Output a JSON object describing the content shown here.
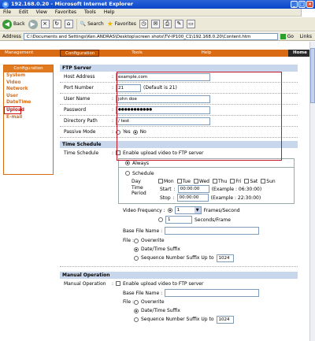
{
  "window": {
    "title": "192.168.0.20 - Microsoft Internet Explorer",
    "menu": [
      "File",
      "Edit",
      "View",
      "Favorites",
      "Tools",
      "Help"
    ],
    "toolbar": {
      "back": "Back",
      "search": "Search",
      "favorites": "Favorites"
    },
    "address_label": "Address",
    "address_value": "C:\\Documents and Settings\\Ken.ANDRAS\\Desktop\\screen shots\\TV-IP100_C1\\192.168.0.20\\Content.htm",
    "go": "Go",
    "links": "Links"
  },
  "nav": {
    "management": "Management",
    "configuration": "Configuration",
    "tools": "Tools",
    "help": "Help",
    "home": "Home"
  },
  "sidebar": {
    "header": "Configuration",
    "items": [
      {
        "label": "System"
      },
      {
        "label": "Video"
      },
      {
        "label": "Network"
      },
      {
        "label": "User"
      },
      {
        "label": "DateTime"
      },
      {
        "label": "Upload"
      },
      {
        "label": "E-mail"
      }
    ],
    "active": "Upload"
  },
  "ftp": {
    "title": "FTP Server",
    "host_label": "Host Address",
    "host_value": "example.com",
    "port_label": "Port Number",
    "port_value": "21",
    "port_default": "(Default is 21)",
    "user_label": "User Name",
    "user_value": "john doe",
    "password_label": "Password",
    "password_value": "●●●●●●●●●●●",
    "dir_label": "Directory Path",
    "dir_value": "/ test",
    "passive_label": "Passive Mode",
    "passive_yes": "Yes",
    "passive_no": "No",
    "passive_selected": "No"
  },
  "schedule": {
    "title": "Time Schedule",
    "row_label": "Time Schedule",
    "enable_label": "Enable upload video to FTP server",
    "always": "Always",
    "schedule": "Schedule",
    "day_label": "Day",
    "days": [
      "Mon",
      "Tue",
      "Wed",
      "Thu",
      "Fri",
      "Sat",
      "Sun"
    ],
    "period_label": "Time Period",
    "start_label": "Start",
    "start_value": "00:00:00",
    "start_example": "(Example : 06:30:00)",
    "stop_label": "Stop",
    "stop_value": "00:00:00",
    "stop_example": "(Example : 22:30:00)",
    "vf_label": "Video Frequency :",
    "fps_value": "1",
    "fps_unit": "Frames/Second",
    "spf_value": "1",
    "spf_unit": "Seconds/Frame",
    "base_label": "Base File Name :",
    "file_label": "File :",
    "overwrite": "Overwrite",
    "datetime_suffix": "Date/Time Suffix",
    "seq_suffix": "Sequence Number Suffix Up to",
    "seq_value": "1024"
  },
  "manual": {
    "title": "Manual Operation",
    "row_label": "Manual Operation",
    "enable_label": "Enable upload video to FTP server",
    "base_label": "Base File Name :",
    "file_label": "File :",
    "overwrite": "Overwrite",
    "datetime_suffix": "Date/Time Suffix",
    "seq_suffix": "Sequence Number Suffix Up to",
    "seq_value": "1024"
  }
}
